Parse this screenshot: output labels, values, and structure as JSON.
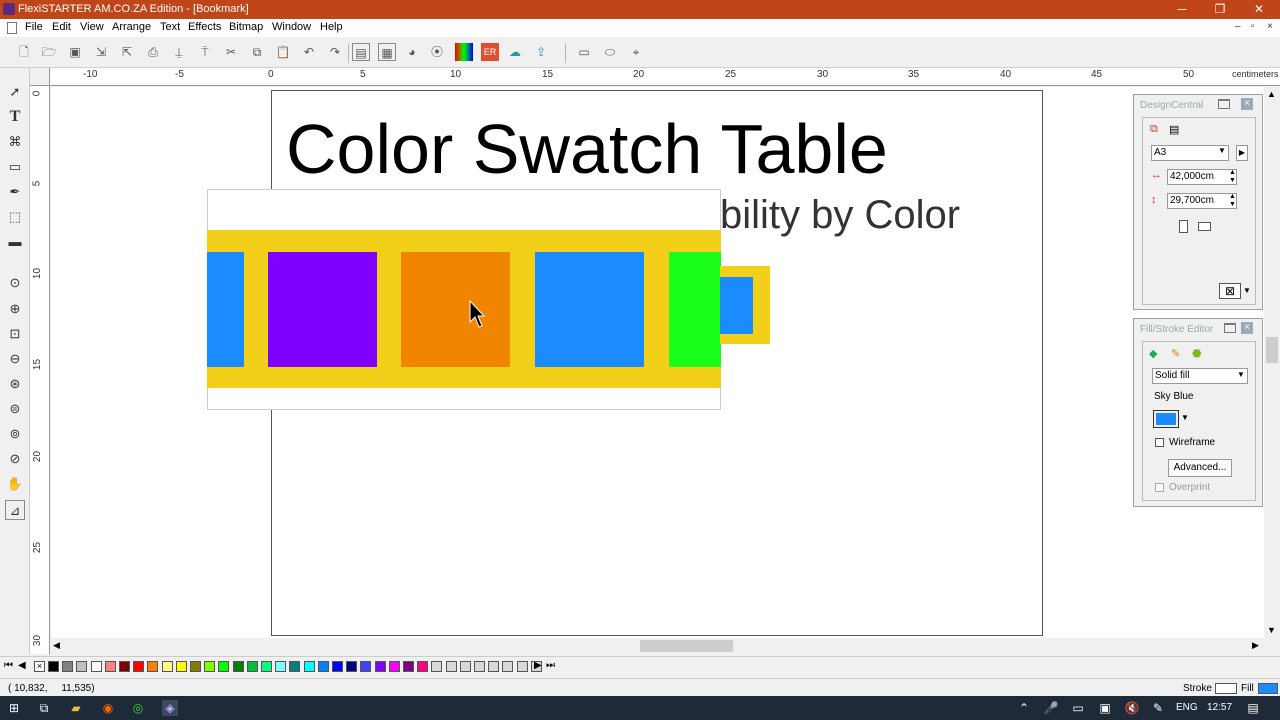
{
  "window": {
    "title": "FlexiSTARTER AM.CO.ZA Edition - [Bookmark]",
    "minimize": "─",
    "restore": "❐",
    "close": "✕"
  },
  "menu": [
    "File",
    "Edit",
    "View",
    "Arrange",
    "Text",
    "Effects",
    "Bitmap",
    "Window",
    "Help"
  ],
  "ruler": {
    "unit": "centimeters",
    "h_labels": [
      "-10",
      "-5",
      "0",
      "5",
      "10",
      "15",
      "20",
      "25",
      "30",
      "35",
      "40",
      "45",
      "50"
    ],
    "v_labels": [
      "0",
      "5",
      "10",
      "15",
      "20",
      "25",
      "30"
    ]
  },
  "document": {
    "heading": "Color Swatch Table",
    "subheading": "bility by Color",
    "swatch_colors": [
      "#1a8cff",
      "#7f00ff",
      "#f28500",
      "#1a8cff",
      "#1aff1a",
      "#1a8cff"
    ],
    "strip_color": "#f2d01a"
  },
  "design_central": {
    "title": "DesignCentral",
    "page_size": "A3",
    "width": "42,000cm",
    "height": "29,700cm"
  },
  "fill_stroke_editor": {
    "title": "Fill/Stroke Editor",
    "fill_type": "Solid fill",
    "color_name": "Sky Blue",
    "color_value": "#1a8cff",
    "wireframe_label": "Wireframe",
    "advanced_button": "Advanced...",
    "overprint_label": "Overprint"
  },
  "palette": [
    "#000000",
    "#808080",
    "#c0c0c0",
    "#ffffff",
    "#ff8080",
    "#800000",
    "#ff0000",
    "#ff8000",
    "#ffff80",
    "#ffff00",
    "#808000",
    "#80ff00",
    "#00ff00",
    "#008000",
    "#00c040",
    "#00ff80",
    "#80ffff",
    "#008080",
    "#00ffff",
    "#0080ff",
    "#0000ff",
    "#000080",
    "#4040ff",
    "#8000ff",
    "#ff00ff",
    "#800080",
    "#ff0080"
  ],
  "status": {
    "coords": "( 10,832,     11,535)",
    "stroke_label": "Stroke",
    "fill_label": "Fill",
    "fill_color": "#1a8cff"
  },
  "taskbar": {
    "lang": "ENG",
    "time": "12:57"
  }
}
